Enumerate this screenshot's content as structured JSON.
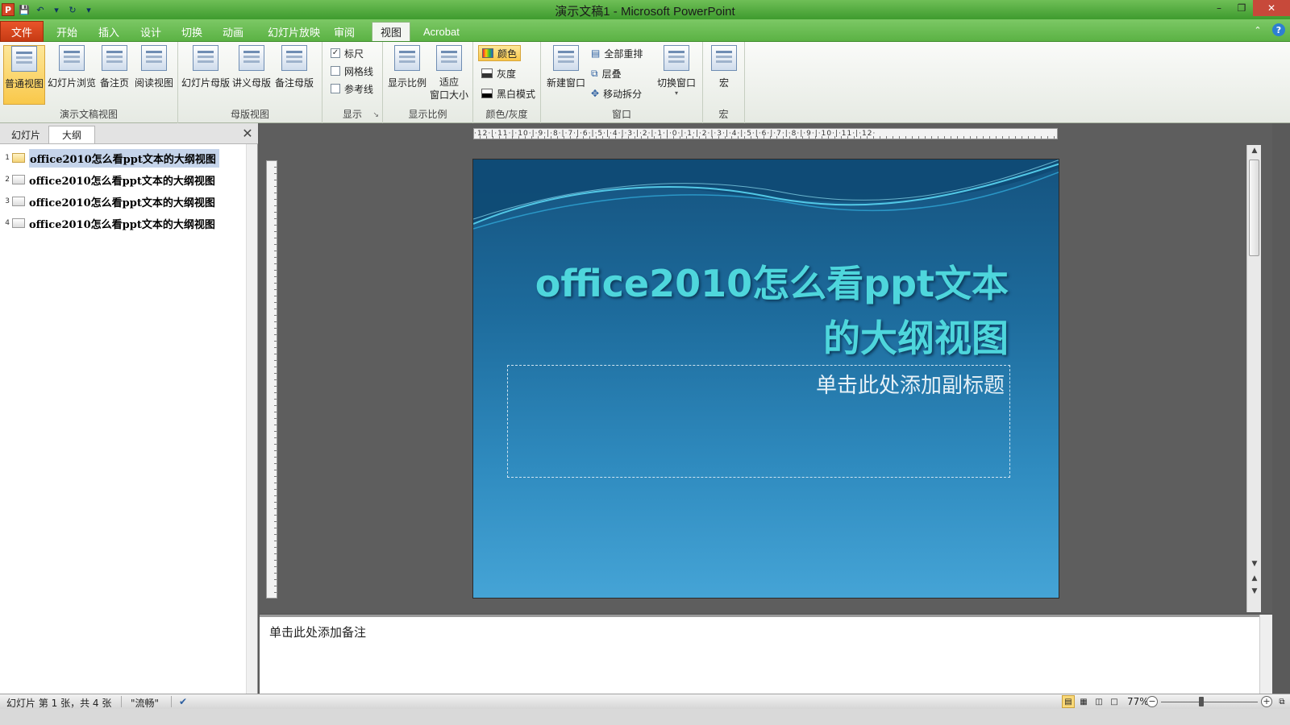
{
  "app": {
    "title": "演示文稿1 - Microsoft PowerPoint",
    "icon": "P"
  },
  "tabs": {
    "file": "文件",
    "items": [
      "开始",
      "插入",
      "设计",
      "切换",
      "动画",
      "幻灯片放映",
      "审阅",
      "视图",
      "Acrobat"
    ],
    "active": "视图"
  },
  "ribbon": {
    "presentation_views": {
      "label": "演示文稿视图",
      "normal": "普通视图",
      "slide_sorter": "幻灯片浏览",
      "notes_page": "备注页",
      "reading_view": "阅读视图"
    },
    "master_views": {
      "label": "母版视图",
      "slide_master": "幻灯片母版",
      "handout_master": "讲义母版",
      "notes_master": "备注母版"
    },
    "show": {
      "label": "显示",
      "ruler": "标尺",
      "gridlines": "网格线",
      "guides": "参考线",
      "ruler_checked": true,
      "gridlines_checked": false,
      "guides_checked": false
    },
    "zoom": {
      "label": "显示比例",
      "zoom": "显示比例",
      "fit_line1": "适应",
      "fit_line2": "窗口大小"
    },
    "color": {
      "label": "颜色/灰度",
      "color": "颜色",
      "grayscale": "灰度",
      "bw": "黑白模式"
    },
    "window": {
      "label": "窗口",
      "new_window": "新建窗口",
      "arrange_all": "全部重排",
      "cascade": "层叠",
      "move_split": "移动拆分",
      "switch_windows": "切换窗口"
    },
    "macros": {
      "label": "宏",
      "macros": "宏"
    }
  },
  "left_pane": {
    "tab_slides": "幻灯片",
    "tab_outline": "大纲",
    "outline_items": [
      {
        "num": "1",
        "text": "office2010怎么看ppt文本的大纲视图"
      },
      {
        "num": "2",
        "text": "office2010怎么看ppt文本的大纲视图"
      },
      {
        "num": "3",
        "text": "office2010怎么看ppt文本的大纲视图"
      },
      {
        "num": "4",
        "text": "office2010怎么看ppt文本的大纲视图"
      }
    ]
  },
  "ruler": {
    "horizontal": "·12·|·11·|·10·|·9·|·8·|·7·|·6·|·5·|·4·|·3·|·2·|·1·|·0·|·1·|·2·|·3·|·4·|·5·|·6·|·7·|·8·|·9·|·10·|·11·|·12·"
  },
  "slide": {
    "title": "office2010怎么看ppt文本的大纲视图",
    "subtitle_placeholder": "单击此处添加副标题"
  },
  "notes": {
    "placeholder": "单击此处添加备注"
  },
  "status": {
    "slide_info": "幻灯片 第 1 张，共 4 张",
    "theme": "\"流畅\"",
    "zoom": "77%",
    "zoom_fraction": 0.42
  },
  "colors": {
    "title_bar": "#3e9b2e",
    "file_tab": "#c63b14",
    "slide_title": "#4ed6dc",
    "selection": "#f9c84a"
  }
}
